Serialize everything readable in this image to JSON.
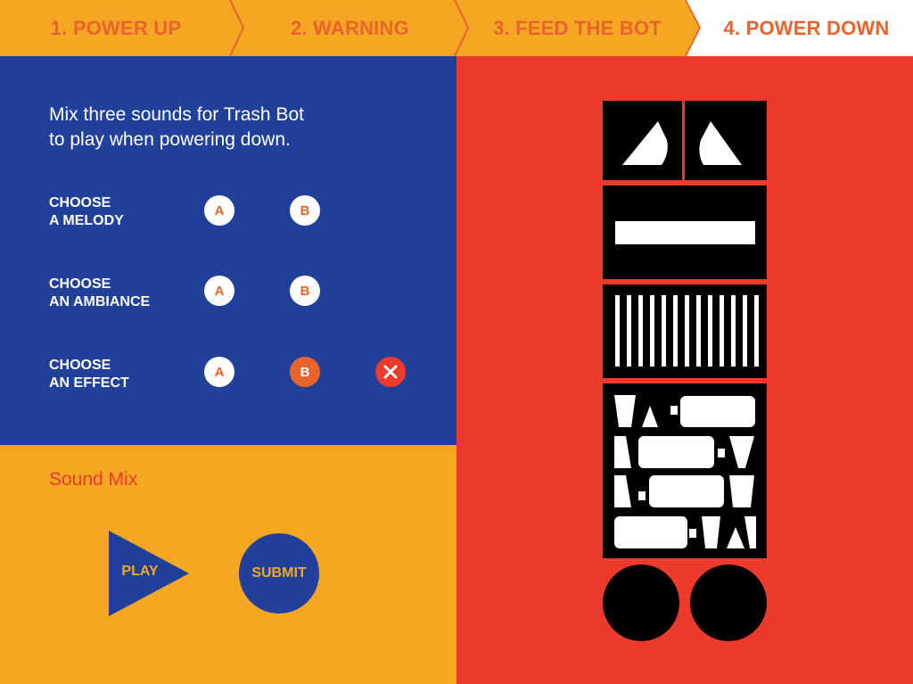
{
  "steps": [
    {
      "label": "1. POWER UP"
    },
    {
      "label": "2. WARNING"
    },
    {
      "label": "3. FEED THE BOT"
    },
    {
      "label": "4. POWER DOWN"
    }
  ],
  "intro": {
    "line1": "Mix three sounds for Trash Bot",
    "line2": "to play when powering down."
  },
  "rows": [
    {
      "label_line1": "CHOOSE",
      "label_line2": "A MELODY",
      "option_a": "A",
      "option_b": "B",
      "selected": ""
    },
    {
      "label_line1": "CHOOSE",
      "label_line2": "AN AMBIANCE",
      "option_a": "A",
      "option_b": "B",
      "selected": ""
    },
    {
      "label_line1": "CHOOSE",
      "label_line2": "AN EFFECT",
      "option_a": "A",
      "option_b": "B",
      "selected": "B",
      "clear_icon": "close-icon"
    }
  ],
  "sound_mix": {
    "title": "Sound Mix",
    "play_label": "PLAY",
    "submit_label": "SUBMIT"
  },
  "colors": {
    "orange": "#f5a623",
    "blue": "#21409a",
    "red": "#ee3a2a",
    "accent": "#e8642c"
  }
}
